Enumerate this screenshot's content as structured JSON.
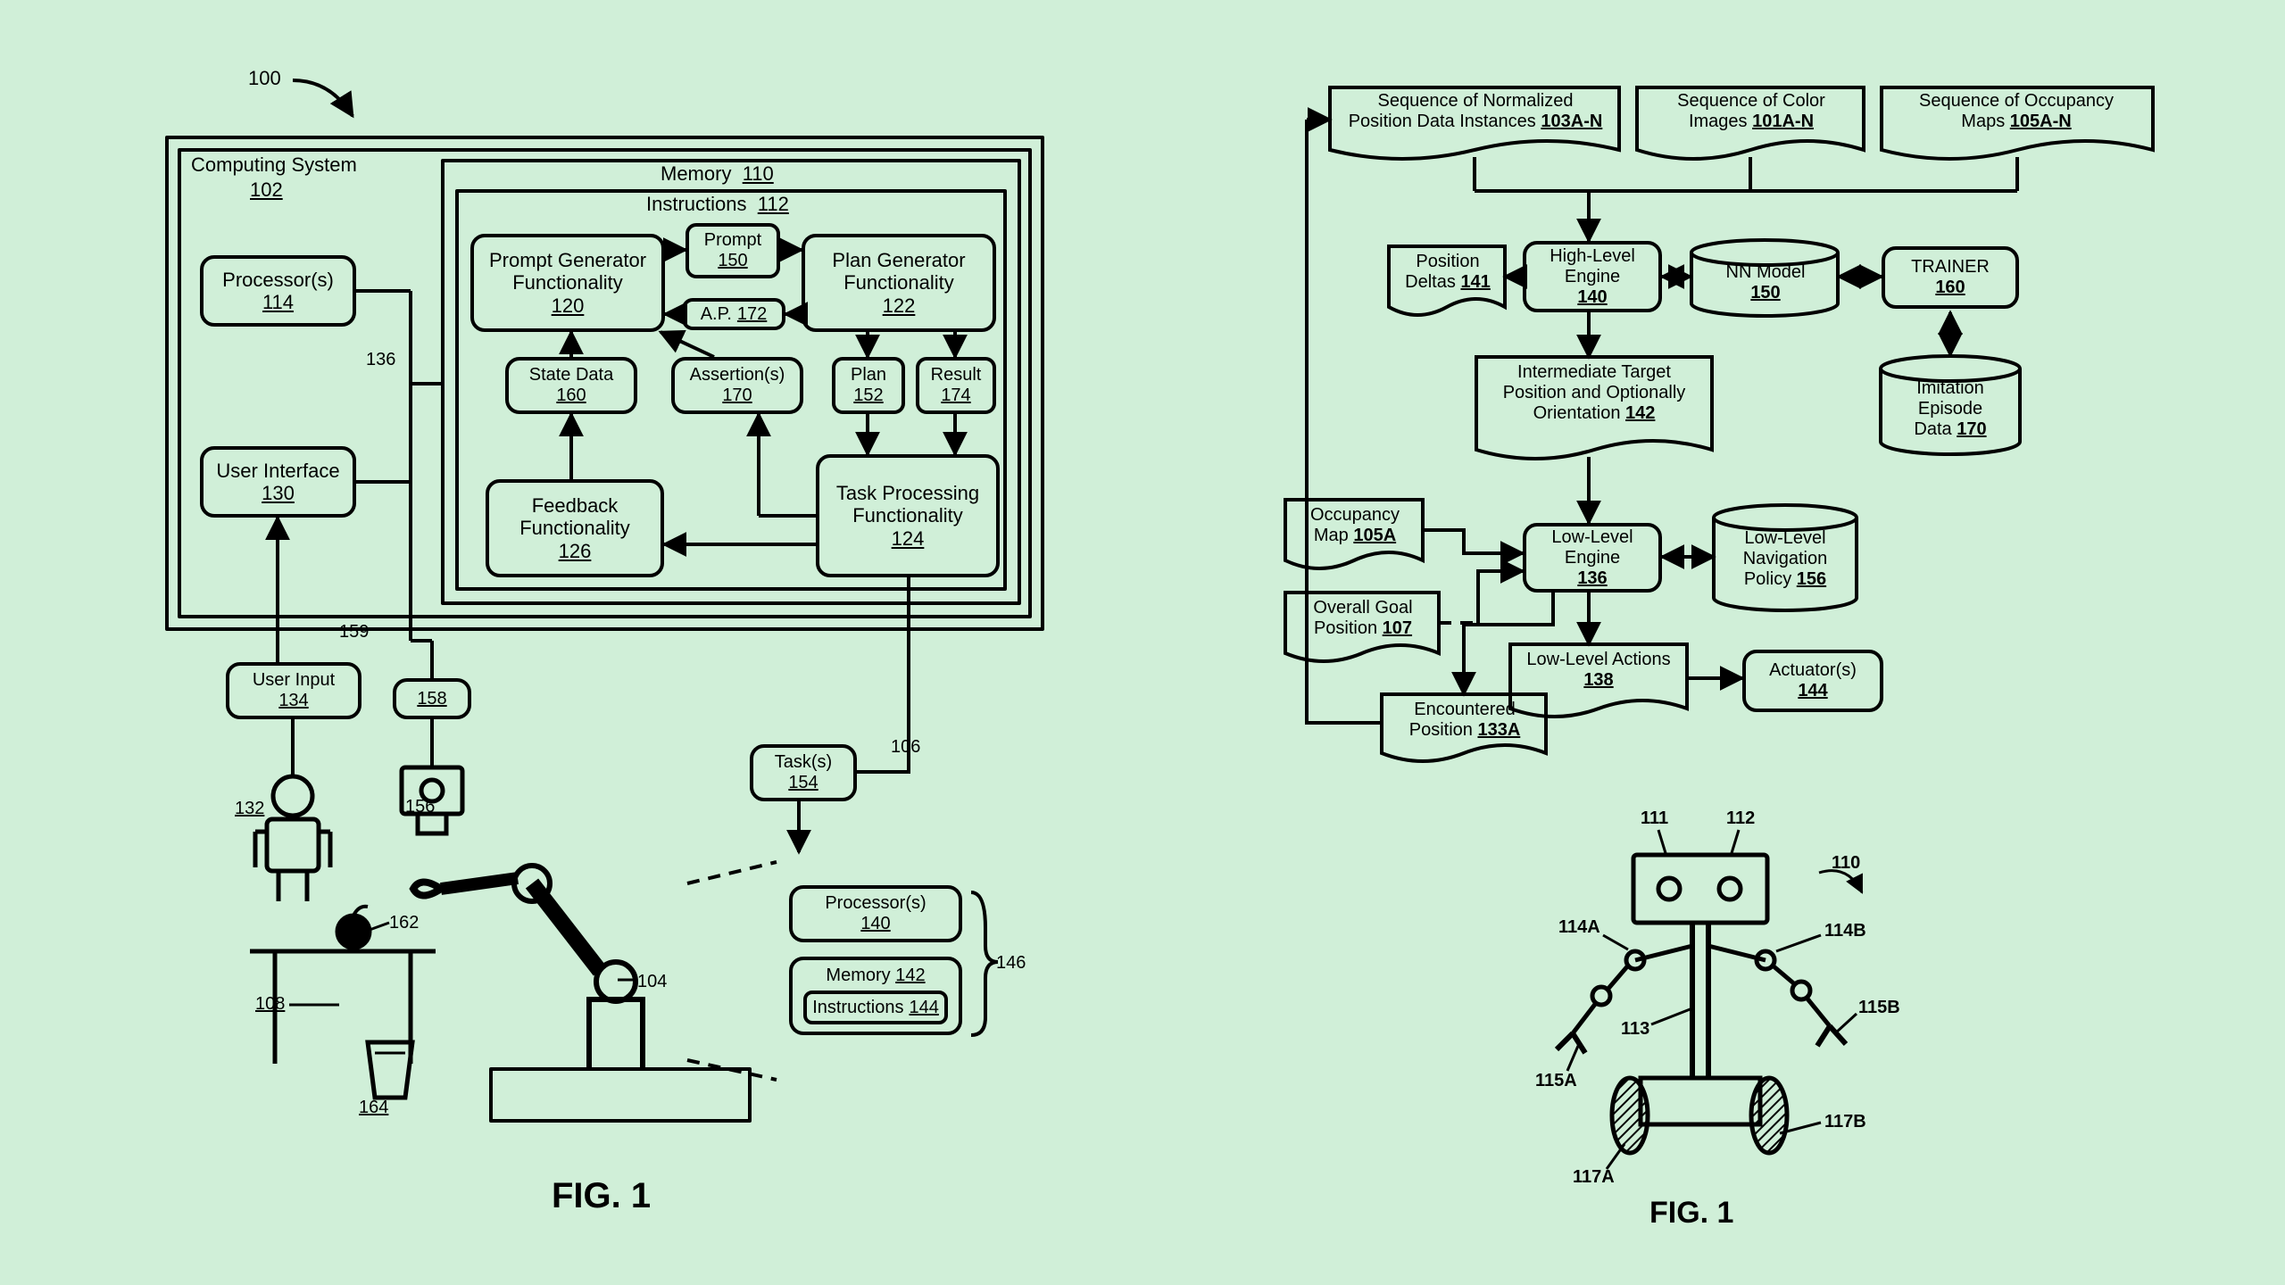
{
  "left": {
    "fig_label": "FIG. 1",
    "ref_100": "100",
    "computing_system": {
      "title": "Computing System",
      "num": "102"
    },
    "processors": {
      "title": "Processor(s)",
      "num": "114"
    },
    "user_interface": {
      "title": "User Interface",
      "num": "130"
    },
    "memory": {
      "title": "Memory",
      "num": "110"
    },
    "instructions": {
      "title": "Instructions",
      "num": "112"
    },
    "prompt_gen": {
      "title": "Prompt Generator Functionality",
      "num": "120"
    },
    "prompt": {
      "title": "Prompt",
      "num": "150"
    },
    "ap": {
      "title": "A.P.",
      "num": "172"
    },
    "plan_gen": {
      "title": "Plan Generator Functionality",
      "num": "122"
    },
    "state_data": {
      "title": "State Data",
      "num": "160"
    },
    "assertions": {
      "title": "Assertion(s)",
      "num": "170"
    },
    "plan": {
      "title": "Plan",
      "num": "152"
    },
    "result": {
      "title": "Result",
      "num": "174"
    },
    "feedback": {
      "title": "Feedback Functionality",
      "num": "126"
    },
    "task_proc": {
      "title": "Task Processing Functionality",
      "num": "124"
    },
    "ref_136": "136",
    "ref_159": "159",
    "user_input": {
      "title": "User Input",
      "num": "134"
    },
    "ref_158": "158",
    "tasks": {
      "title": "Task(s)",
      "num": "154"
    },
    "ref_106": "106",
    "ref_132": "132",
    "ref_156": "156",
    "ref_162": "162",
    "ref_108": "108",
    "ref_104": "104",
    "ref_164": "164",
    "robot_proc": {
      "title": "Processor(s)",
      "num": "140"
    },
    "robot_mem_label": "Memory",
    "robot_mem_num": "142",
    "robot_instr": {
      "title": "Instructions",
      "num": "144"
    },
    "ref_146": "146"
  },
  "right": {
    "fig_label": "FIG. 1",
    "seq_norm_pos": {
      "line1": "Sequence of Normalized",
      "line2": "Position Data Instances",
      "num": "103A-N"
    },
    "seq_color": {
      "line1": "Sequence of Color",
      "line2": "Images",
      "num": "101A-N"
    },
    "seq_occ": {
      "line1": "Sequence of Occupancy",
      "line2": "Maps",
      "num": "105A-N"
    },
    "pos_deltas": {
      "title": "Position Deltas",
      "num": "141"
    },
    "high_level": {
      "title": "High-Level Engine",
      "num": "140"
    },
    "nn_model": {
      "title": "NN Model",
      "num": "150"
    },
    "trainer": {
      "title": "TRAINER",
      "num": "160"
    },
    "imitation": {
      "line1": "Imitation",
      "line2": "Episode",
      "line3": "Data",
      "num": "170"
    },
    "intermediate": {
      "line1": "Intermediate Target",
      "line2": "Position and Optionally",
      "line3": "Orientation",
      "num": "142"
    },
    "occ_map": {
      "title": "Occupancy Map",
      "num": "105A"
    },
    "low_level_engine": {
      "title": "Low-Level Engine",
      "num": "136"
    },
    "low_level_nav": {
      "line1": "Low-Level",
      "line2": "Navigation",
      "line3": "Policy",
      "num": "156"
    },
    "overall_goal": {
      "title": "Overall Goal Position",
      "num": "107"
    },
    "encountered": {
      "title": "Encountered Position",
      "num": "133A"
    },
    "low_actions": {
      "title": "Low-Level Actions",
      "num": "138"
    },
    "actuators": {
      "title": "Actuator(s)",
      "num": "144"
    },
    "robot_refs": {
      "r110": "110",
      "r111": "111",
      "r112": "112",
      "r113": "113",
      "r114A": "114A",
      "r114B": "114B",
      "r115A": "115A",
      "r115B": "115B",
      "r117A": "117A",
      "r117B": "117B"
    }
  }
}
